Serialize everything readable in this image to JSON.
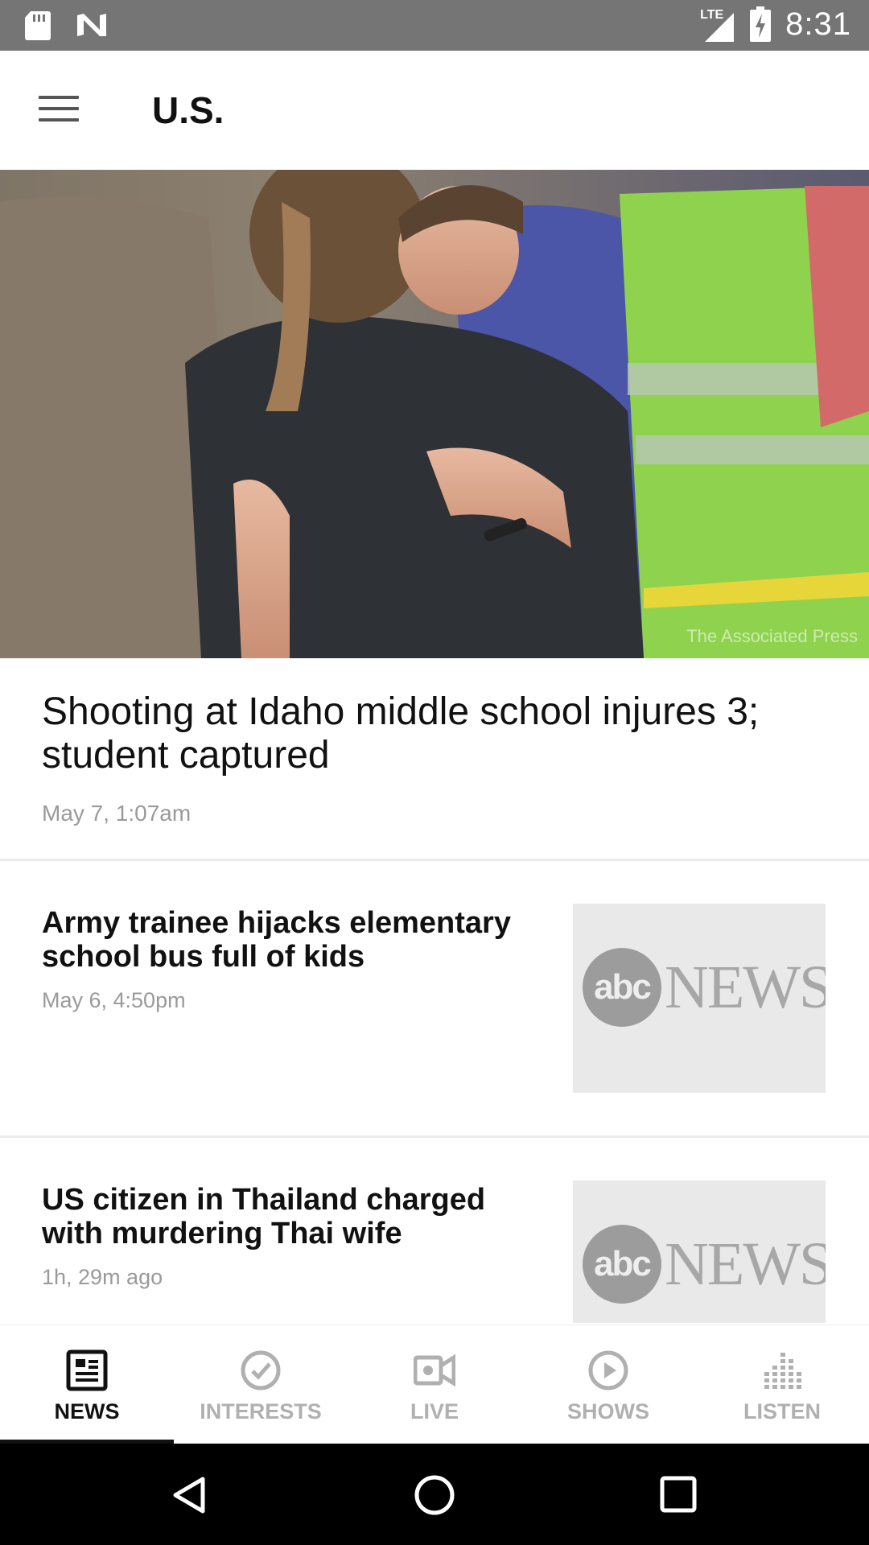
{
  "status_bar": {
    "time": "8:31",
    "network": "LTE",
    "icons": [
      "sd-card-icon",
      "n-logo-icon",
      "signal-icon",
      "battery-charging-icon"
    ]
  },
  "app_bar": {
    "title": "U.S.",
    "menu_icon": "hamburger-menu-icon"
  },
  "hero": {
    "credit": "The Associated Press",
    "headline": "Shooting at Idaho middle school injures 3; student captured",
    "date": "May 7, 1:07am"
  },
  "articles": [
    {
      "title": "Army trainee hijacks elementary school bus full of kids",
      "date": "May 6, 4:50pm",
      "thumb_logo_abc": "abc",
      "thumb_logo_news": "NEWS"
    },
    {
      "title": "US citizen in Thailand charged with murdering Thai wife",
      "date": "1h, 29m ago",
      "thumb_logo_abc": "abc",
      "thumb_logo_news": "NEWS"
    }
  ],
  "bottom_nav": {
    "items": [
      {
        "label": "NEWS",
        "icon": "newspaper-icon",
        "active": true
      },
      {
        "label": "INTERESTS",
        "icon": "check-circle-icon",
        "active": false
      },
      {
        "label": "LIVE",
        "icon": "video-camera-icon",
        "active": false
      },
      {
        "label": "SHOWS",
        "icon": "play-circle-icon",
        "active": false
      },
      {
        "label": "LISTEN",
        "icon": "equalizer-icon",
        "active": false
      }
    ]
  },
  "colors": {
    "status_bar": "#757575",
    "text_primary": "#111111",
    "text_secondary": "#9a9a9a",
    "nav_inactive": "#b0b0b0"
  }
}
